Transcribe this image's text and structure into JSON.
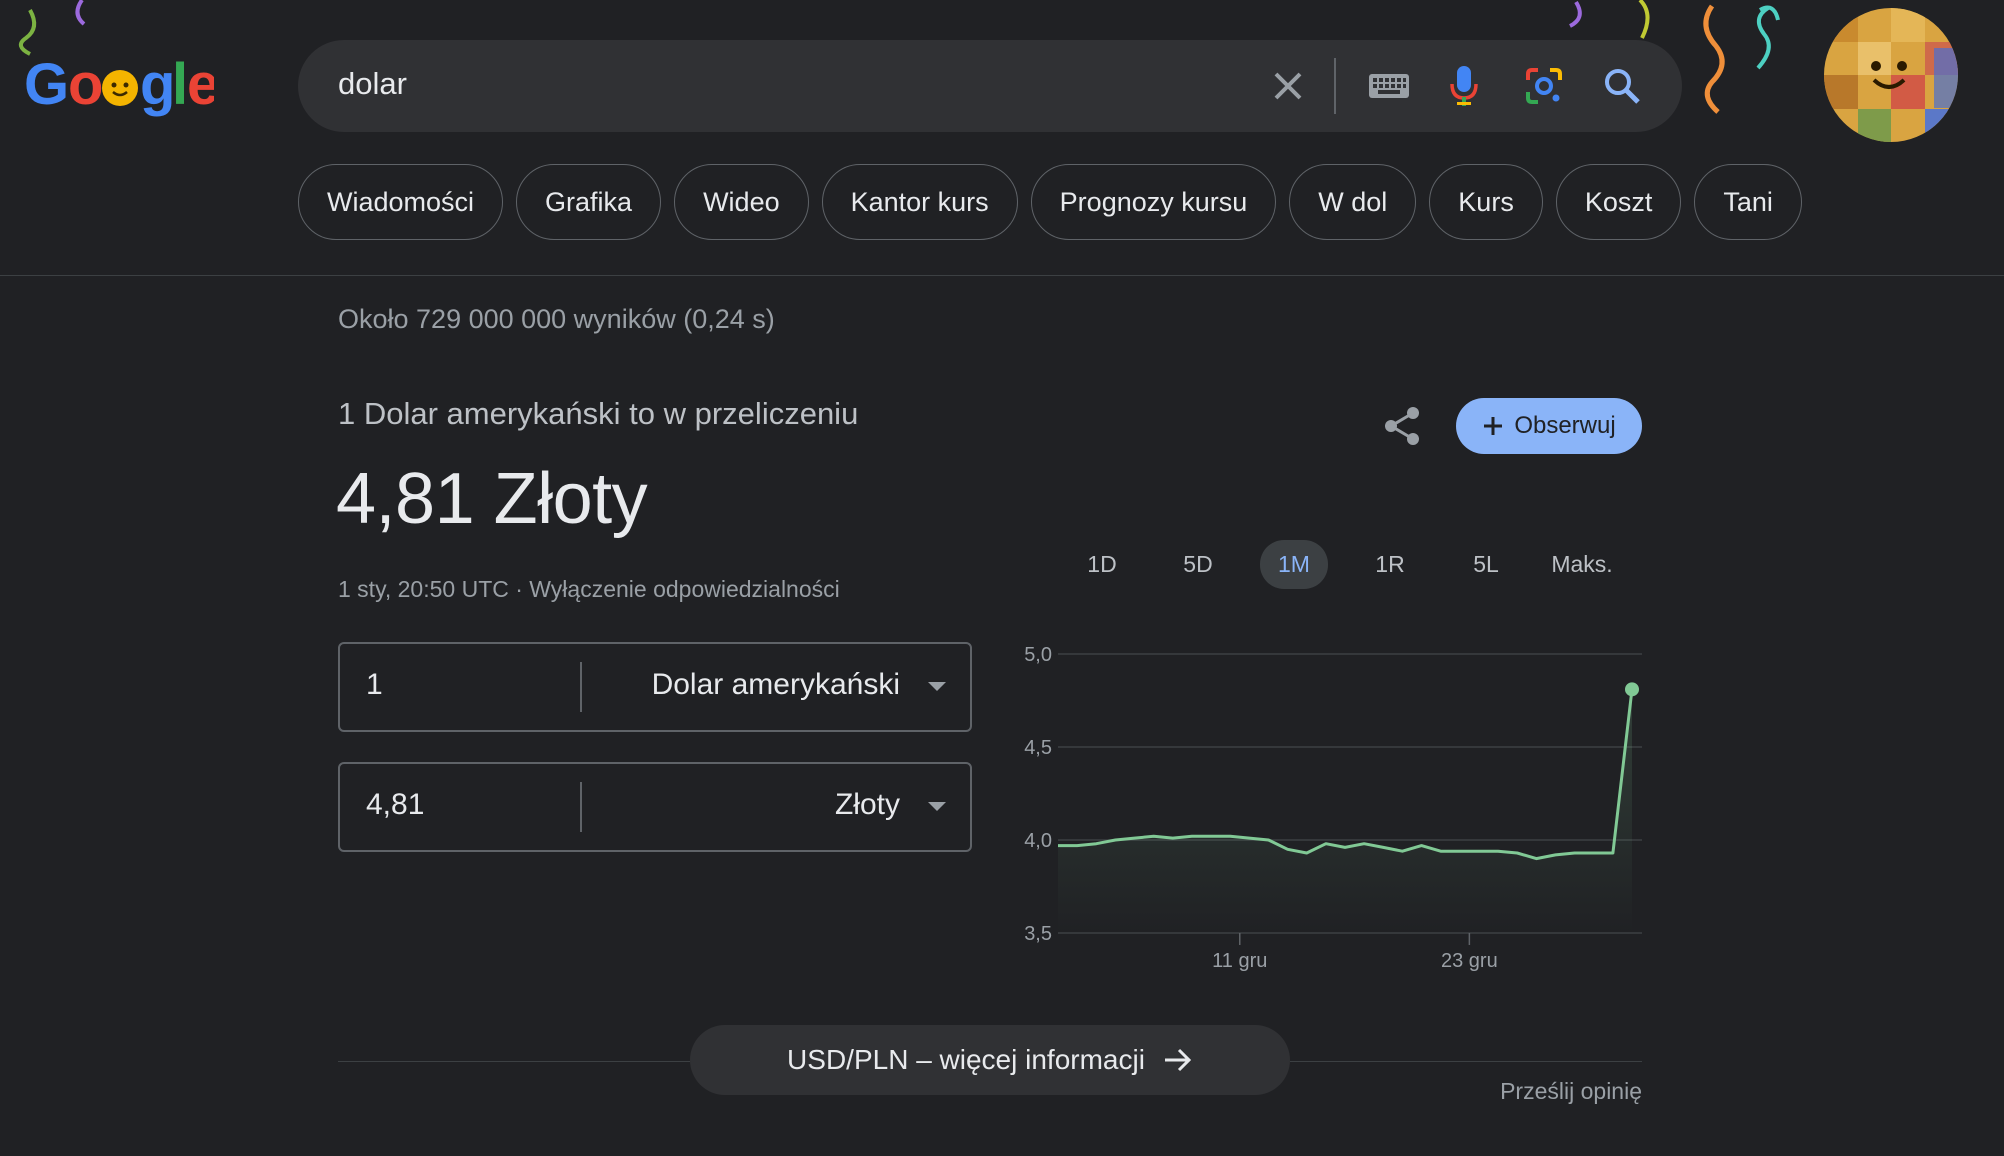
{
  "header": {
    "logo_text": "Google",
    "search_value": "dolar",
    "icons": [
      "close-icon",
      "keyboard-icon",
      "mic-icon",
      "lens-icon",
      "search-icon"
    ]
  },
  "chips": [
    "Wiadomości",
    "Grafika",
    "Wideo",
    "Kantor kurs",
    "Prognozy kursu",
    "W dol",
    "Kurs",
    "Koszt",
    "Tani"
  ],
  "results": {
    "stats": "Około 729 000 000 wyników (0,24 s)"
  },
  "converter": {
    "label": "1 Dolar amerykański to w przeliczeniu",
    "result": "4,81 Złoty",
    "updated": "1 sty, 20:50 UTC · Wyłączenie odpowiedzialności",
    "from_value": "1",
    "from_unit": "Dolar amerykański",
    "to_value": "4,81",
    "to_unit": "Złoty",
    "follow_label": "Obserwuj",
    "ranges": [
      "1D",
      "5D",
      "1M",
      "1R",
      "5L",
      "Maks."
    ],
    "active_range": "1M",
    "more_label": "USD/PLN – więcej informacji",
    "feedback": "Prześlij opinię"
  },
  "colors": {
    "accent": "#8ab4f8",
    "line": "#81c995",
    "background": "#202124"
  },
  "chart_data": {
    "type": "line",
    "ylim": [
      3.5,
      5.0
    ],
    "yticks": [
      "5,0",
      "4,5",
      "4,0",
      "3,5"
    ],
    "ytick_values": [
      5.0,
      4.5,
      4.0,
      3.5
    ],
    "xtick_labels": [
      "11 gru",
      "23 gru"
    ],
    "xtick_index": [
      9.5,
      21.5
    ],
    "grid": true,
    "series": [
      {
        "values": [
          3.97,
          3.97,
          3.98,
          4.0,
          4.01,
          4.02,
          4.01,
          4.02,
          4.02,
          4.02,
          4.01,
          4.0,
          3.95,
          3.93,
          3.98,
          3.96,
          3.98,
          3.96,
          3.94,
          3.97,
          3.94,
          3.94,
          3.94,
          3.94,
          3.93,
          3.9,
          3.92,
          3.93,
          3.93,
          3.93,
          4.81
        ]
      }
    ]
  }
}
